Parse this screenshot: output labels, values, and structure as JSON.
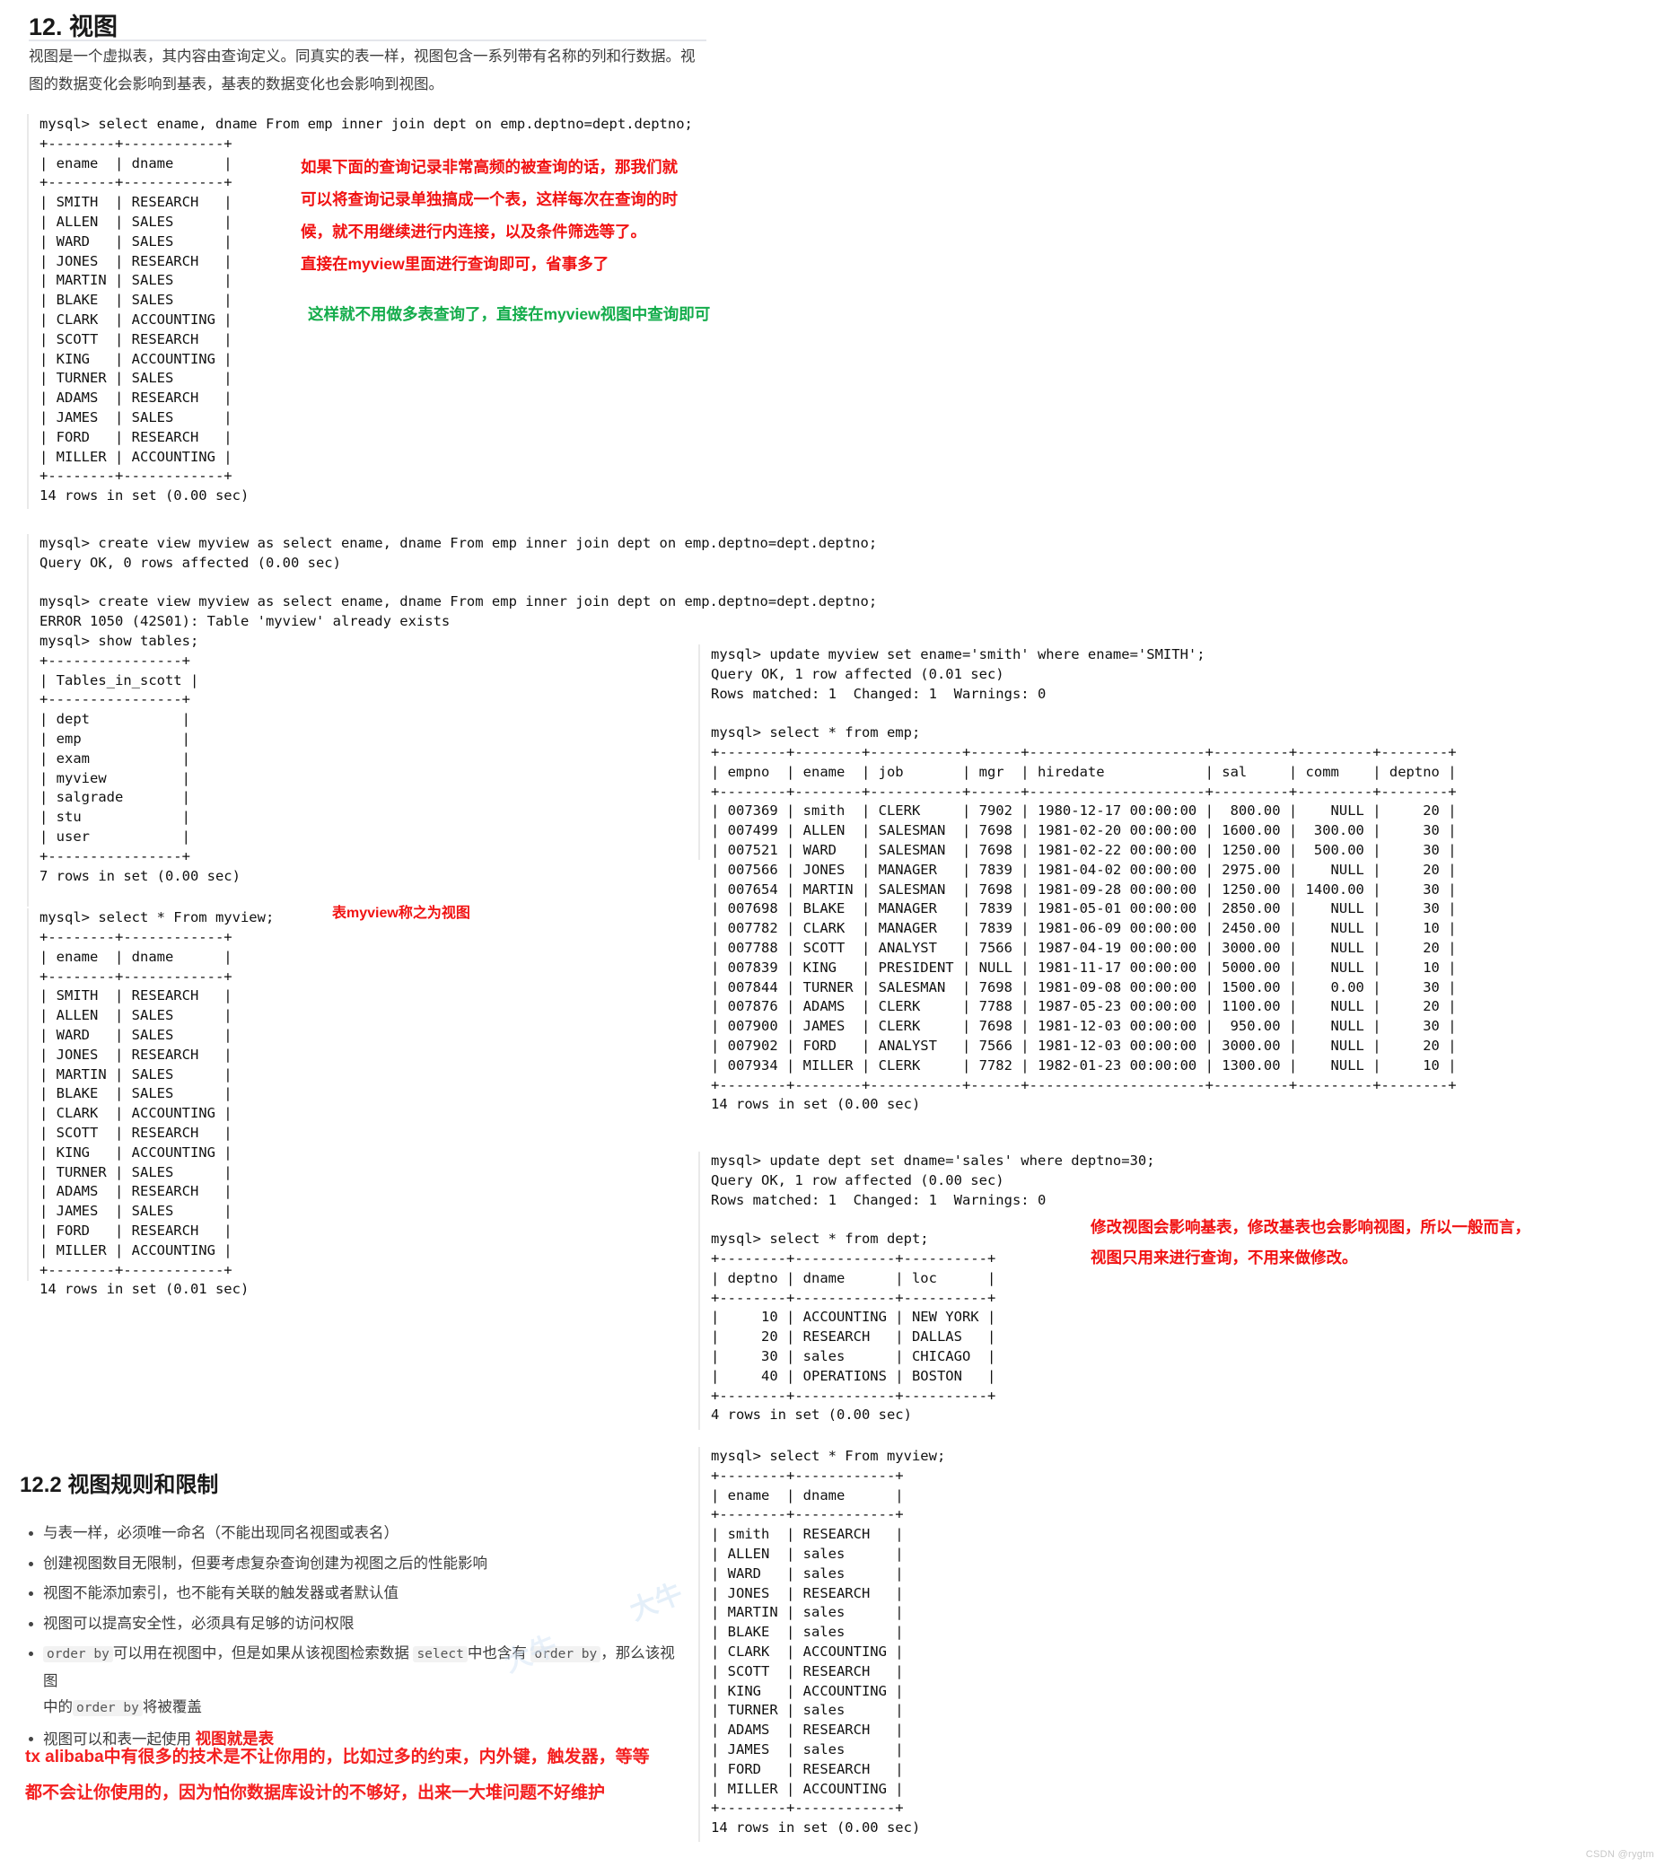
{
  "section": {
    "title": "12. 视图",
    "intro_line1": "视图是一个虚拟表，其内容由查询定义。同真实的表一样，视图包含一系列带有名称的列和行数据。视",
    "intro_line2": "图的数据变化会影响到基表，基表的数据变化也会影响到视图。",
    "subtitle": "12.2 视图规则和限制"
  },
  "terminal": {
    "block1": "mysql> select ename, dname From emp inner join dept on emp.deptno=dept.deptno;\n+--------+------------+\n| ename  | dname      |\n+--------+------------+\n| SMITH  | RESEARCH   |\n| ALLEN  | SALES      |\n| WARD   | SALES      |\n| JONES  | RESEARCH   |\n| MARTIN | SALES      |\n| BLAKE  | SALES      |\n| CLARK  | ACCOUNTING |\n| SCOTT  | RESEARCH   |\n| KING   | ACCOUNTING |\n| TURNER | SALES      |\n| ADAMS  | RESEARCH   |\n| JAMES  | SALES      |\n| FORD   | RESEARCH   |\n| MILLER | ACCOUNTING |\n+--------+------------+\n14 rows in set (0.00 sec)",
    "block2": "mysql> create view myview as select ename, dname From emp inner join dept on emp.deptno=dept.deptno;\nQuery OK, 0 rows affected (0.00 sec)\n\nmysql> create view myview as select ename, dname From emp inner join dept on emp.deptno=dept.deptno;\nERROR 1050 (42S01): Table 'myview' already exists\nmysql> show tables;\n+----------------+\n| Tables_in_scott |\n+----------------+\n| dept           |\n| emp            |\n| exam           |\n| myview         |\n| salgrade       |\n| stu            |\n| user           |\n+----------------+\n7 rows in set (0.00 sec)",
    "block3_prompt": "mysql> select * From myview;",
    "block3": "+--------+------------+\n| ename  | dname      |\n+--------+------------+\n| SMITH  | RESEARCH   |\n| ALLEN  | SALES      |\n| WARD   | SALES      |\n| JONES  | RESEARCH   |\n| MARTIN | SALES      |\n| BLAKE  | SALES      |\n| CLARK  | ACCOUNTING |\n| SCOTT  | RESEARCH   |\n| KING   | ACCOUNTING |\n| TURNER | SALES      |\n| ADAMS  | RESEARCH   |\n| JAMES  | SALES      |\n| FORD   | RESEARCH   |\n| MILLER | ACCOUNTING |\n+--------+------------+\n14 rows in set (0.01 sec)",
    "block4": "mysql> update myview set ename='smith' where ename='SMITH';\nQuery OK, 1 row affected (0.01 sec)\nRows matched: 1  Changed: 1  Warnings: 0\n\nmysql> select * from emp;\n+--------+--------+-----------+------+---------------------+---------+---------+--------+\n| empno  | ename  | job       | mgr  | hiredate            | sal     | comm    | deptno |\n+--------+--------+-----------+------+---------------------+---------+---------+--------+\n| 007369 | smith  | CLERK     | 7902 | 1980-12-17 00:00:00 |  800.00 |    NULL |     20 |\n| 007499 | ALLEN  | SALESMAN  | 7698 | 1981-02-20 00:00:00 | 1600.00 |  300.00 |     30 |\n| 007521 | WARD   | SALESMAN  | 7698 | 1981-02-22 00:00:00 | 1250.00 |  500.00 |     30 |\n| 007566 | JONES  | MANAGER   | 7839 | 1981-04-02 00:00:00 | 2975.00 |    NULL |     20 |\n| 007654 | MARTIN | SALESMAN  | 7698 | 1981-09-28 00:00:00 | 1250.00 | 1400.00 |     30 |\n| 007698 | BLAKE  | MANAGER   | 7839 | 1981-05-01 00:00:00 | 2850.00 |    NULL |     30 |\n| 007782 | CLARK  | MANAGER   | 7839 | 1981-06-09 00:00:00 | 2450.00 |    NULL |     10 |\n| 007788 | SCOTT  | ANALYST   | 7566 | 1987-04-19 00:00:00 | 3000.00 |    NULL |     20 |\n| 007839 | KING   | PRESIDENT | NULL | 1981-11-17 00:00:00 | 5000.00 |    NULL |     10 |\n| 007844 | TURNER | SALESMAN  | 7698 | 1981-09-08 00:00:00 | 1500.00 |    0.00 |     30 |\n| 007876 | ADAMS  | CLERK     | 7788 | 1987-05-23 00:00:00 | 1100.00 |    NULL |     20 |\n| 007900 | JAMES  | CLERK     | 7698 | 1981-12-03 00:00:00 |  950.00 |    NULL |     30 |\n| 007902 | FORD   | ANALYST   | 7566 | 1981-12-03 00:00:00 | 3000.00 |    NULL |     20 |\n| 007934 | MILLER | CLERK     | 7782 | 1982-01-23 00:00:00 | 1300.00 |    NULL |     10 |\n+--------+--------+-----------+------+---------------------+---------+---------+--------+\n14 rows in set (0.00 sec)",
    "block5": "mysql> update dept set dname='sales' where deptno=30;\nQuery OK, 1 row affected (0.00 sec)\nRows matched: 1  Changed: 1  Warnings: 0\n\nmysql> select * from dept;\n+--------+------------+----------+\n| deptno | dname      | loc      |\n+--------+------------+----------+\n|     10 | ACCOUNTING | NEW YORK |\n|     20 | RESEARCH   | DALLAS   |\n|     30 | sales      | CHICAGO  |\n|     40 | OPERATIONS | BOSTON   |\n+--------+------------+----------+\n4 rows in set (0.00 sec)",
    "block6": "mysql> select * From myview;\n+--------+------------+\n| ename  | dname      |\n+--------+------------+\n| smith  | RESEARCH   |\n| ALLEN  | sales      |\n| WARD   | sales      |\n| JONES  | RESEARCH   |\n| MARTIN | sales      |\n| BLAKE  | sales      |\n| CLARK  | ACCOUNTING |\n| SCOTT  | RESEARCH   |\n| KING   | ACCOUNTING |\n| TURNER | sales      |\n| ADAMS  | RESEARCH   |\n| JAMES  | sales      |\n| FORD   | RESEARCH   |\n| MILLER | ACCOUNTING |\n+--------+------------+\n14 rows in set (0.00 sec)"
  },
  "annotations": {
    "red1": "如果下面的查询记录非常高频的被查询的话，那我们就\n可以将查询记录单独搞成一个表，这样每次在查询的时\n候，就不用继续进行内连接，以及条件筛选等了。\n直接在myview里面进行查询即可，省事多了",
    "green1": "这样就不用做多表查询了，直接在myview视图中查询即可",
    "red2": "表myview称之为视图",
    "red3": "修改视图会影响基表，修改基表也会影响视图，所以一般而言，\n视图只用来进行查询，不用来做修改。",
    "red4": "tx alibaba中有很多的技术是不让你用的，比如过多的约束，内外键，触发器，等等\n都不会让你使用的，因为怕你数据库设计的不够好，出来一大堆问题不好维护"
  },
  "rules": {
    "item1": "与表一样，必须唯一命名（不能出现同名视图或表名）",
    "item2": "创建视图数目无限制，但要考虑复杂查询创建为视图之后的性能影响",
    "item3": "视图不能添加索引，也不能有关联的触发器或者默认值",
    "item4": "视图可以提高安全性，必须具有足够的访问权限",
    "item5_a": "order by",
    "item5_b": "可以用在视图中，但是如果从该视图检索数据",
    "item5_c": "select",
    "item5_d": "中也含有",
    "item5_e": "order by",
    "item5_f": "，那么该视图",
    "item5_g": "中的",
    "item5_h": "order by",
    "item5_i": "将被覆盖",
    "item6_a": "视图可以和表一起使用",
    "item6_b": "视图就是表"
  },
  "watermark": {
    "text": "CSDN @rygtm",
    "bg1": "大牛",
    "bg2": "大牛"
  },
  "colors": {
    "red": "#f11212",
    "green": "#14ac4b",
    "text": "#3c3c3c"
  }
}
